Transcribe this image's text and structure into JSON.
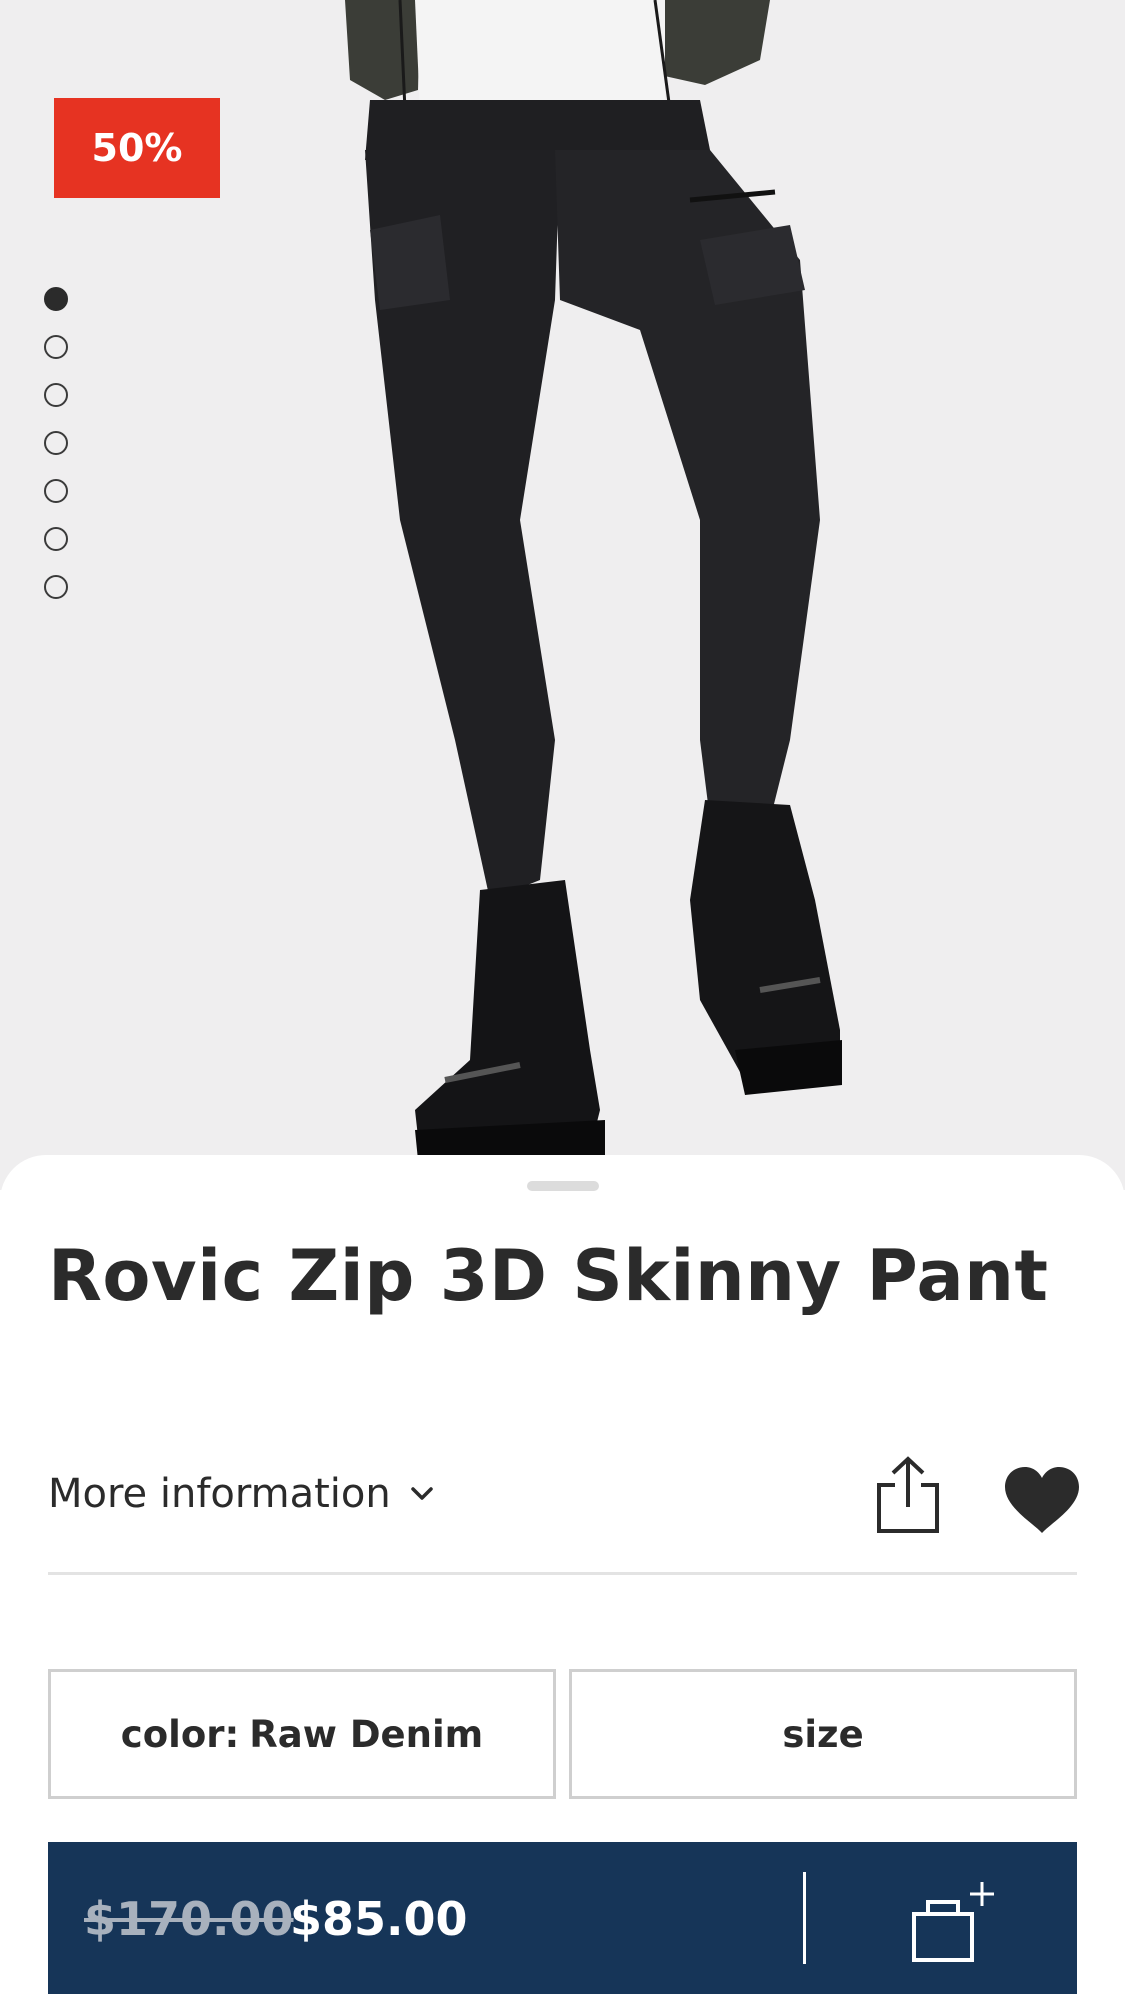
{
  "hero": {
    "discount_badge": "50%",
    "carousel": {
      "total": 7,
      "active_index": 0
    }
  },
  "product": {
    "title": "Rovic Zip 3D Skinny Pant"
  },
  "actions": {
    "more_info_label": "More information",
    "share_icon": "share-icon",
    "favorite_icon": "heart-icon"
  },
  "options": {
    "color_label": "color:",
    "color_value": "Raw Denim",
    "size_label": "size"
  },
  "purchase": {
    "original_price": "$170.00",
    "sale_price": "$85.00",
    "add_to_bag_icon": "bag-plus-icon"
  },
  "colors": {
    "badge": "#e63322",
    "buy_bar": "#163558",
    "text": "#2b2b2b"
  }
}
